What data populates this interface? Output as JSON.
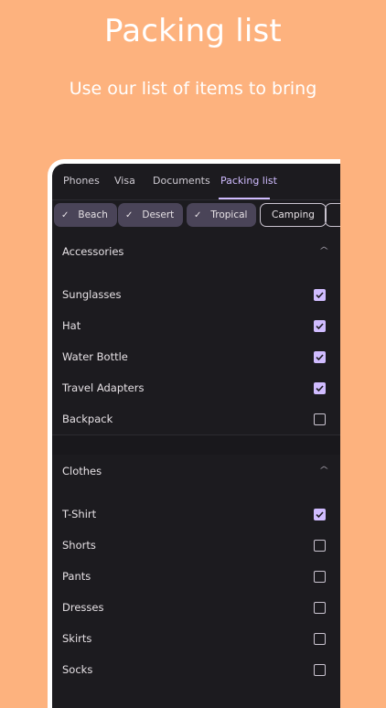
{
  "hero": {
    "title": "Packing list",
    "subtitle": "Use our list of items to bring"
  },
  "tabs": [
    {
      "label": "Phones",
      "active": false
    },
    {
      "label": "Visa",
      "active": false
    },
    {
      "label": "Documents",
      "active": false
    },
    {
      "label": "Packing list",
      "active": true
    }
  ],
  "chips": [
    {
      "label": "Beach",
      "selected": true
    },
    {
      "label": "Desert",
      "selected": true
    },
    {
      "label": "Tropical",
      "selected": true
    },
    {
      "label": "Camping",
      "selected": false
    }
  ],
  "sections": [
    {
      "title": "Accessories",
      "items": [
        {
          "label": "Sunglasses",
          "checked": true
        },
        {
          "label": "Hat",
          "checked": true
        },
        {
          "label": "Water Bottle",
          "checked": true
        },
        {
          "label": "Travel Adapters",
          "checked": true
        },
        {
          "label": "Backpack",
          "checked": false
        }
      ]
    },
    {
      "title": "Clothes",
      "items": [
        {
          "label": "T-Shirt",
          "checked": true
        },
        {
          "label": "Shorts",
          "checked": false
        },
        {
          "label": "Pants",
          "checked": false
        },
        {
          "label": "Dresses",
          "checked": false
        },
        {
          "label": "Skirts",
          "checked": false
        },
        {
          "label": "Socks",
          "checked": false
        }
      ]
    }
  ],
  "colors": {
    "background": "#FDB27E",
    "surface": "#1C1B1F",
    "accent": "#D0BCFF",
    "chip_selected": "#4A4458"
  }
}
